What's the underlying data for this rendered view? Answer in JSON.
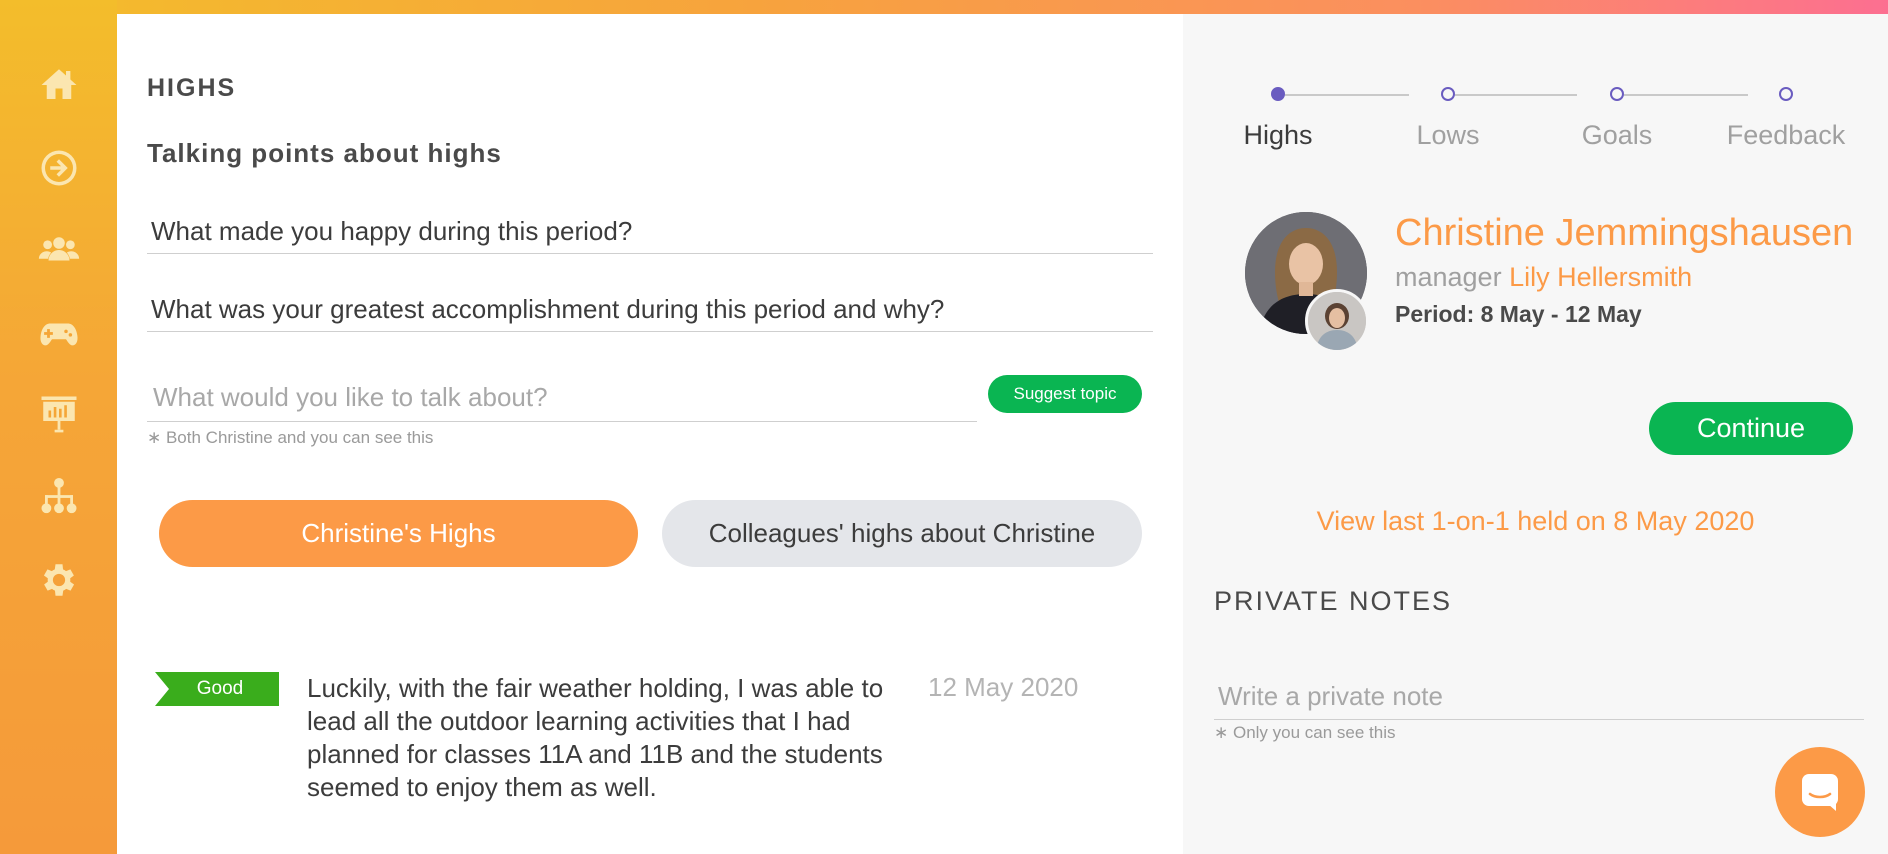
{
  "colors": {
    "accent_orange": "#fc9a47",
    "green": "#0ab552",
    "badge_green": "#3aad1c",
    "step_purple": "#6a5cc0",
    "sidebar_gradient_top": "#f3bd2b",
    "sidebar_gradient_bottom": "#f59a3a"
  },
  "sidebar": {
    "items": [
      {
        "icon": "home-icon"
      },
      {
        "icon": "arrow-circle-right-icon"
      },
      {
        "icon": "users-group-icon"
      },
      {
        "icon": "gamepad-icon"
      },
      {
        "icon": "presentation-board-icon"
      },
      {
        "icon": "org-chart-icon"
      },
      {
        "icon": "gear-icon"
      }
    ]
  },
  "main": {
    "title": "HIGHS",
    "subtitle": "Talking points about highs",
    "questions": [
      "What made you happy during this period?",
      "What was your greatest accomplishment during this period and why?"
    ],
    "topic_input": {
      "value": "",
      "placeholder": "What would you like to talk about?"
    },
    "suggest_button": "Suggest topic",
    "visibility_hint": "∗ Both Christine and you can see this",
    "tabs": {
      "own": "Christine's Highs",
      "colleagues": "Colleagues' highs about Christine"
    },
    "entry": {
      "badge": "Good",
      "text": "Luckily, with the fair weather holding, I was able to lead all the outdoor learning activities that I had planned for classes 11A and 11B and the students seemed to enjoy them as well.",
      "date": "12 May 2020"
    }
  },
  "right": {
    "steps": [
      {
        "label": "Highs",
        "active": true
      },
      {
        "label": "Lows",
        "active": false
      },
      {
        "label": "Goals",
        "active": false
      },
      {
        "label": "Feedback",
        "active": false
      }
    ],
    "person_name": "Christine Jemmingshausen",
    "manager_label": "manager",
    "manager_name": "Lily Hellersmith",
    "period": "Period: 8 May - 12 May",
    "continue_button": "Continue",
    "last_meeting_link": "View last 1-on-1 held on 8 May 2020",
    "private_notes_title": "PRIVATE NOTES",
    "note_input": {
      "value": "",
      "placeholder": "Write a private note"
    },
    "note_hint": "∗ Only you can see this",
    "chat_icon": "chat-bubble-icon"
  }
}
